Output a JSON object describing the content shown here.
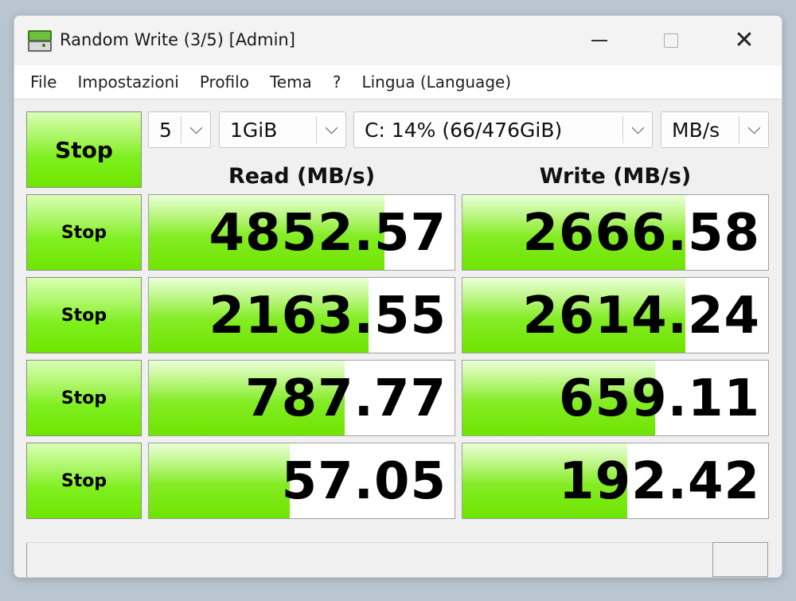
{
  "window": {
    "title": "Random Write (3/5) [Admin]",
    "close_glyph": "✕"
  },
  "menu": [
    "File",
    "Impostazioni",
    "Profilo",
    "Tema",
    "?",
    "Lingua (Language)"
  ],
  "controls": {
    "main_button": "Stop",
    "count": "5",
    "size": "1GiB",
    "drive": "C: 14% (66/476GiB)",
    "unit": "MB/s"
  },
  "headers": {
    "read": "Read (MB/s)",
    "write": "Write (MB/s)"
  },
  "rows": [
    {
      "button": "Stop",
      "read": "4852.57",
      "write": "2666.58",
      "read_fill_pct": 77,
      "write_fill_pct": 73
    },
    {
      "button": "Stop",
      "read": "2163.55",
      "write": "2614.24",
      "read_fill_pct": 72,
      "write_fill_pct": 73
    },
    {
      "button": "Stop",
      "read": "787.77",
      "write": "659.11",
      "read_fill_pct": 64,
      "write_fill_pct": 63
    },
    {
      "button": "Stop",
      "read": "57.05",
      "write": "192.42",
      "read_fill_pct": 46,
      "write_fill_pct": 54
    }
  ],
  "status": {
    "text": ""
  },
  "colors": {
    "bar_green": "#6fe400",
    "button_green": "#7fef1f"
  }
}
